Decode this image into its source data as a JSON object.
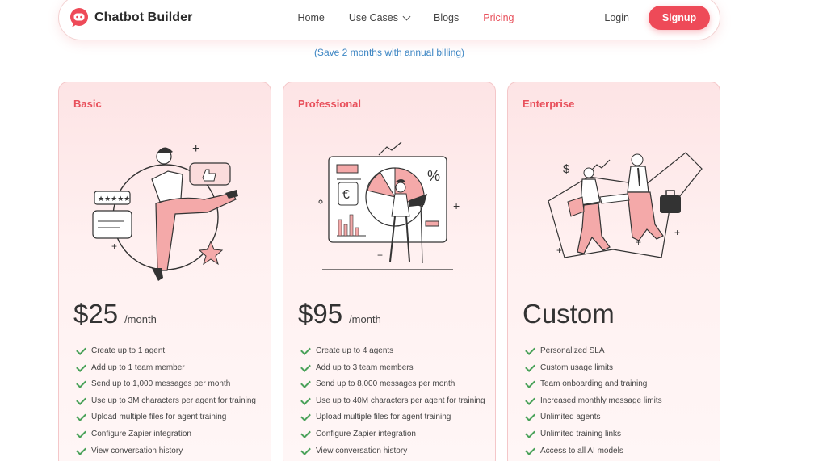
{
  "nav": {
    "brand": "Chatbot Builder",
    "links": {
      "home": "Home",
      "use_cases": "Use Cases",
      "blogs": "Blogs",
      "pricing": "Pricing"
    },
    "login": "Login",
    "signup": "Signup",
    "accent": "#ee4a58"
  },
  "billing_note": "(Save 2 months with annual billing)",
  "plans": [
    {
      "name": "Basic",
      "price": "$25",
      "period": "/month",
      "features": [
        "Create up to 1 agent",
        "Add up to 1 team member",
        "Send up to 1,000 messages per month",
        "Use up to 3M characters per agent for training",
        "Upload multiple files for agent training",
        "Configure Zapier integration",
        "View conversation history"
      ]
    },
    {
      "name": "Professional",
      "price": "$95",
      "period": "/month",
      "features": [
        "Create up to 4 agents",
        "Add up to 3 team members",
        "Send up to 8,000 messages per month",
        "Use up to 40M characters per agent for training",
        "Upload multiple files for agent training",
        "Configure Zapier integration",
        "View conversation history"
      ]
    },
    {
      "name": "Enterprise",
      "price": "Custom",
      "features": [
        "Personalized SLA",
        "Custom usage limits",
        "Team onboarding and training",
        "Increased monthly message limits",
        "Unlimited agents",
        "Unlimited training links",
        "Access to all AI models"
      ]
    }
  ],
  "icons": {
    "logo": "chat-bubble-robot-icon",
    "check": "check-icon"
  },
  "colors": {
    "plan_title": "#e8505b",
    "check": "#4aa25a",
    "link": "#3b86c4"
  }
}
